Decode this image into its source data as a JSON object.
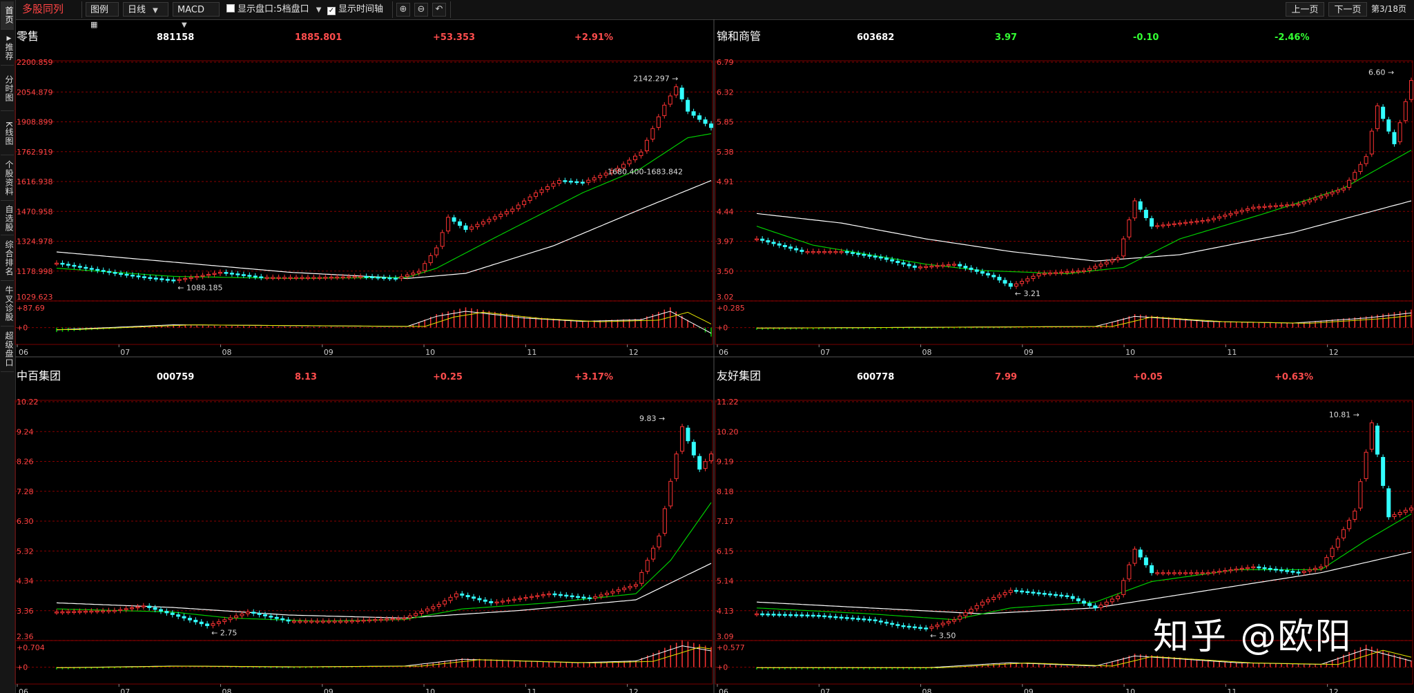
{
  "app": {
    "title": "多股同列"
  },
  "toolbar": {
    "legend_label": "图例",
    "period": "日线",
    "indicator": "MACD",
    "check_order_book": "显示盘口:5档盘口",
    "check_time_axis": "显示时间轴",
    "prev_page": "上一页",
    "next_page": "下一页",
    "page_indicator": "第3/18页"
  },
  "sidebar": {
    "items": [
      {
        "label": "首页"
      },
      {
        "label": "推荐"
      },
      {
        "label": "分时图"
      },
      {
        "label": "K线图"
      },
      {
        "label": "个股资料"
      },
      {
        "label": "自选股"
      },
      {
        "label": "综合排名"
      },
      {
        "label": "牛叉诊股"
      },
      {
        "label": "超级盘口"
      }
    ]
  },
  "watermark": "知乎 @欧阳",
  "colors": {
    "up": "#ff3333",
    "down": "#33ffff",
    "ma_short": "#00cc00",
    "ma_long": "#ffffff",
    "grid": "#8a0000",
    "axis_label": "#ff4444"
  },
  "panels": [
    {
      "name": "零售",
      "code": "881158",
      "price": "1885.801",
      "change": "+53.353",
      "pct": "+2.91%",
      "price_color": "#ff4d4d",
      "change_color": "#ff4d4d",
      "ylabels": [
        "2200.859",
        "2054.879",
        "1908.899",
        "1762.919",
        "1616.938",
        "1470.958",
        "1324.978",
        "1178.998",
        "1029.623"
      ],
      "macd_labels": [
        "+87.69",
        "+0"
      ],
      "months": [
        "06",
        "07",
        "08",
        "09",
        "10",
        "11",
        "12"
      ],
      "annotations": {
        "high": "2142.297",
        "low": "1088.185",
        "range": "1680.400-1683.842"
      },
      "chart_data": {
        "type": "candlestick",
        "ylim": [
          1029.623,
          2200.859
        ],
        "trend": [
          [
            0,
            1215
          ],
          [
            10,
            1165
          ],
          [
            15,
            1145
          ],
          [
            20,
            1130
          ],
          [
            28,
            1170
          ],
          [
            35,
            1145
          ],
          [
            45,
            1145
          ],
          [
            52,
            1150
          ],
          [
            58,
            1140
          ],
          [
            62,
            1175
          ],
          [
            65,
            1290
          ],
          [
            67,
            1440
          ],
          [
            70,
            1380
          ],
          [
            78,
            1480
          ],
          [
            82,
            1560
          ],
          [
            86,
            1620
          ],
          [
            90,
            1610
          ],
          [
            96,
            1680
          ],
          [
            100,
            1760
          ],
          [
            104,
            1990
          ],
          [
            106,
            2080
          ],
          [
            108,
            1960
          ],
          [
            112,
            1880
          ]
        ],
        "ma_short": [
          [
            0,
            1190
          ],
          [
            20,
            1150
          ],
          [
            40,
            1140
          ],
          [
            60,
            1145
          ],
          [
            65,
            1190
          ],
          [
            75,
            1340
          ],
          [
            90,
            1560
          ],
          [
            100,
            1680
          ],
          [
            108,
            1830
          ],
          [
            112,
            1850
          ]
        ],
        "ma_long": [
          [
            0,
            1270
          ],
          [
            20,
            1220
          ],
          [
            40,
            1170
          ],
          [
            60,
            1140
          ],
          [
            70,
            1165
          ],
          [
            85,
            1300
          ],
          [
            100,
            1480
          ],
          [
            112,
            1620
          ]
        ],
        "macd_hist": [
          [
            0,
            -0.2
          ],
          [
            20,
            0.1
          ],
          [
            40,
            0.05
          ],
          [
            60,
            0.0
          ],
          [
            65,
            0.6
          ],
          [
            70,
            0.9
          ],
          [
            80,
            0.5
          ],
          [
            90,
            0.3
          ],
          [
            100,
            0.4
          ],
          [
            105,
            0.9
          ],
          [
            112,
            -0.4
          ]
        ]
      }
    },
    {
      "name": "锦和商管",
      "code": "603682",
      "price": "3.97",
      "change": "-0.10",
      "pct": "-2.46%",
      "price_color": "#33ff33",
      "change_color": "#33ff33",
      "ylabels": [
        "6.79",
        "6.32",
        "5.85",
        "5.38",
        "4.91",
        "4.44",
        "3.97",
        "3.50",
        "3.02"
      ],
      "macd_labels": [
        "+0.285",
        "+0"
      ],
      "months": [
        "06",
        "07",
        "08",
        "09",
        "10",
        "11",
        "12"
      ],
      "annotations": {
        "high": "6.60",
        "low": "3.21"
      },
      "chart_data": {
        "type": "candlestick",
        "ylim": [
          3.02,
          6.79
        ],
        "trend": [
          [
            0,
            4.0
          ],
          [
            8,
            3.8
          ],
          [
            15,
            3.8
          ],
          [
            22,
            3.7
          ],
          [
            28,
            3.55
          ],
          [
            35,
            3.6
          ],
          [
            42,
            3.4
          ],
          [
            45,
            3.25
          ],
          [
            50,
            3.45
          ],
          [
            58,
            3.5
          ],
          [
            64,
            3.7
          ],
          [
            67,
            4.6
          ],
          [
            70,
            4.2
          ],
          [
            80,
            4.3
          ],
          [
            88,
            4.5
          ],
          [
            96,
            4.55
          ],
          [
            104,
            4.8
          ],
          [
            108,
            5.3
          ],
          [
            110,
            6.1
          ],
          [
            113,
            5.5
          ],
          [
            116,
            6.5
          ]
        ],
        "ma_short": [
          [
            0,
            4.2
          ],
          [
            10,
            3.9
          ],
          [
            20,
            3.75
          ],
          [
            30,
            3.6
          ],
          [
            40,
            3.5
          ],
          [
            55,
            3.45
          ],
          [
            65,
            3.55
          ],
          [
            75,
            4.0
          ],
          [
            90,
            4.4
          ],
          [
            104,
            4.8
          ],
          [
            116,
            5.4
          ]
        ],
        "ma_long": [
          [
            0,
            4.4
          ],
          [
            15,
            4.25
          ],
          [
            30,
            4.0
          ],
          [
            45,
            3.8
          ],
          [
            60,
            3.65
          ],
          [
            75,
            3.75
          ],
          [
            95,
            4.1
          ],
          [
            116,
            4.6
          ]
        ],
        "macd_hist": [
          [
            0,
            -0.1
          ],
          [
            30,
            -0.05
          ],
          [
            60,
            0.0
          ],
          [
            67,
            0.6
          ],
          [
            80,
            0.3
          ],
          [
            95,
            0.2
          ],
          [
            108,
            0.5
          ],
          [
            116,
            0.8
          ]
        ]
      }
    },
    {
      "name": "中百集团",
      "code": "000759",
      "price": "8.13",
      "change": "+0.25",
      "pct": "+3.17%",
      "price_color": "#ff4d4d",
      "change_color": "#ff4d4d",
      "ylabels": [
        "10.22",
        "9.24",
        "8.26",
        "7.28",
        "6.30",
        "5.32",
        "4.34",
        "3.36",
        "2.36"
      ],
      "macd_labels": [
        "+0.704",
        "+0"
      ],
      "months": [
        "06",
        "07",
        "08",
        "09",
        "10",
        "11",
        "12"
      ],
      "annotations": {
        "high": "9.83",
        "low": "2.75"
      },
      "chart_data": {
        "type": "candlestick",
        "ylim": [
          2.36,
          10.22
        ],
        "trend": [
          [
            0,
            3.3
          ],
          [
            10,
            3.35
          ],
          [
            15,
            3.5
          ],
          [
            22,
            3.1
          ],
          [
            26,
            2.85
          ],
          [
            33,
            3.3
          ],
          [
            40,
            3.0
          ],
          [
            50,
            3.0
          ],
          [
            60,
            3.1
          ],
          [
            66,
            3.55
          ],
          [
            69,
            3.9
          ],
          [
            75,
            3.6
          ],
          [
            85,
            3.9
          ],
          [
            92,
            3.75
          ],
          [
            100,
            4.2
          ],
          [
            104,
            5.8
          ],
          [
            108,
            9.4
          ],
          [
            111,
            8.0
          ],
          [
            113,
            8.5
          ]
        ],
        "ma_short": [
          [
            0,
            3.4
          ],
          [
            20,
            3.3
          ],
          [
            30,
            3.1
          ],
          [
            45,
            3.0
          ],
          [
            60,
            3.05
          ],
          [
            70,
            3.4
          ],
          [
            85,
            3.6
          ],
          [
            100,
            3.9
          ],
          [
            106,
            5.0
          ],
          [
            113,
            6.9
          ]
        ],
        "ma_long": [
          [
            0,
            3.6
          ],
          [
            20,
            3.45
          ],
          [
            40,
            3.2
          ],
          [
            60,
            3.1
          ],
          [
            80,
            3.35
          ],
          [
            100,
            3.7
          ],
          [
            113,
            4.9
          ]
        ],
        "macd_hist": [
          [
            0,
            -0.1
          ],
          [
            20,
            0.0
          ],
          [
            40,
            -0.05
          ],
          [
            60,
            0.0
          ],
          [
            70,
            0.4
          ],
          [
            90,
            0.2
          ],
          [
            100,
            0.3
          ],
          [
            108,
            1.2
          ],
          [
            113,
            0.9
          ]
        ]
      }
    },
    {
      "name": "友好集团",
      "code": "600778",
      "price": "7.99",
      "change": "+0.05",
      "pct": "+0.63%",
      "price_color": "#ff4d4d",
      "change_color": "#ff4d4d",
      "ylabels": [
        "11.22",
        "10.20",
        "9.19",
        "8.18",
        "7.17",
        "6.15",
        "5.14",
        "4.13",
        "3.09"
      ],
      "macd_labels": [
        "+0.577",
        "+0"
      ],
      "months": [
        "06",
        "07",
        "08",
        "09",
        "10",
        "11",
        "12"
      ],
      "annotations": {
        "high": "10.81",
        "low": "3.50"
      },
      "chart_data": {
        "type": "candlestick",
        "ylim": [
          3.09,
          11.22
        ],
        "trend": [
          [
            0,
            4.0
          ],
          [
            10,
            3.95
          ],
          [
            20,
            3.8
          ],
          [
            25,
            3.6
          ],
          [
            30,
            3.5
          ],
          [
            35,
            3.8
          ],
          [
            40,
            4.4
          ],
          [
            45,
            4.8
          ],
          [
            55,
            4.6
          ],
          [
            60,
            4.2
          ],
          [
            64,
            4.6
          ],
          [
            67,
            6.2
          ],
          [
            70,
            5.4
          ],
          [
            80,
            5.4
          ],
          [
            88,
            5.6
          ],
          [
            96,
            5.4
          ],
          [
            100,
            5.6
          ],
          [
            106,
            7.5
          ],
          [
            109,
            10.5
          ],
          [
            112,
            7.3
          ],
          [
            116,
            7.6
          ]
        ],
        "ma_short": [
          [
            0,
            4.2
          ],
          [
            20,
            4.0
          ],
          [
            35,
            3.8
          ],
          [
            45,
            4.2
          ],
          [
            60,
            4.4
          ],
          [
            70,
            5.1
          ],
          [
            85,
            5.5
          ],
          [
            100,
            5.5
          ],
          [
            108,
            6.5
          ],
          [
            116,
            7.4
          ]
        ],
        "ma_long": [
          [
            0,
            4.4
          ],
          [
            20,
            4.2
          ],
          [
            40,
            4.0
          ],
          [
            60,
            4.2
          ],
          [
            80,
            4.8
          ],
          [
            100,
            5.4
          ],
          [
            116,
            6.1
          ]
        ],
        "macd_hist": [
          [
            0,
            -0.1
          ],
          [
            30,
            -0.1
          ],
          [
            45,
            0.2
          ],
          [
            60,
            0.0
          ],
          [
            67,
            0.6
          ],
          [
            85,
            0.2
          ],
          [
            100,
            0.1
          ],
          [
            108,
            1.0
          ],
          [
            116,
            0.3
          ]
        ]
      }
    }
  ]
}
